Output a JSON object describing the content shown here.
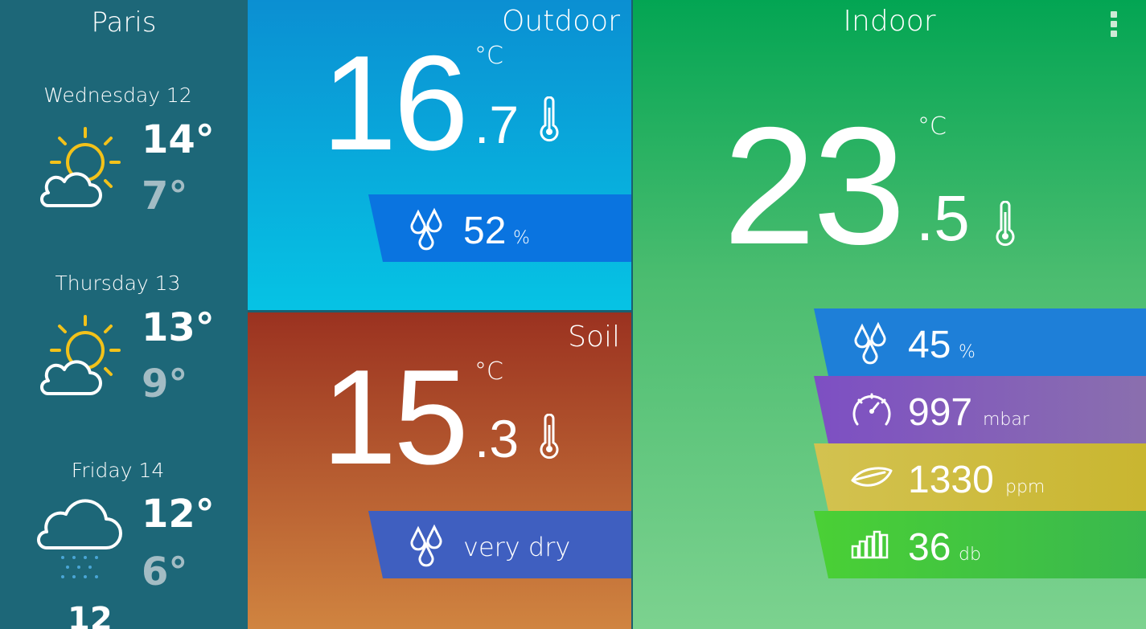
{
  "sidebar": {
    "city": "Paris",
    "days": [
      {
        "label": "Wednesday 12",
        "high": "14°",
        "low": "7°",
        "icon": "sun-cloud-icon"
      },
      {
        "label": "Thursday 13",
        "high": "13°",
        "low": "9°",
        "icon": "sun-cloud-icon"
      },
      {
        "label": "Friday 14",
        "high": "12°",
        "low": "6°",
        "icon": "rain-cloud-icon"
      }
    ],
    "next_peek": "12"
  },
  "outdoor": {
    "title": "Outdoor",
    "temp_int": "16",
    "temp_dec": ".7",
    "unit": "°C",
    "humidity_value": "52",
    "humidity_unit": "%"
  },
  "soil": {
    "title": "Soil",
    "temp_int": "15",
    "temp_dec": ".3",
    "unit": "°C",
    "moisture": "very dry"
  },
  "indoor": {
    "title": "Indoor",
    "temp_int": "23",
    "temp_dec": ".5",
    "unit": "°C",
    "metrics": [
      {
        "value": "45",
        "unit": "%",
        "icon": "humidity-drops-icon",
        "color": "#1e7fd8"
      },
      {
        "value": "997",
        "unit": "mbar",
        "icon": "pressure-gauge-icon",
        "color": "#7a5cc0"
      },
      {
        "value": "1330",
        "unit": "ppm",
        "icon": "leaf-icon",
        "color": "#cdbd35"
      },
      {
        "value": "36",
        "unit": "db",
        "icon": "noise-bars-icon",
        "color": "#45c93c"
      }
    ]
  },
  "colors": {
    "sidebar": "#1d6778",
    "outdoor_band": "#0a74e0",
    "soil_band": "#3f5fc0",
    "sun": "#f2c21a"
  }
}
